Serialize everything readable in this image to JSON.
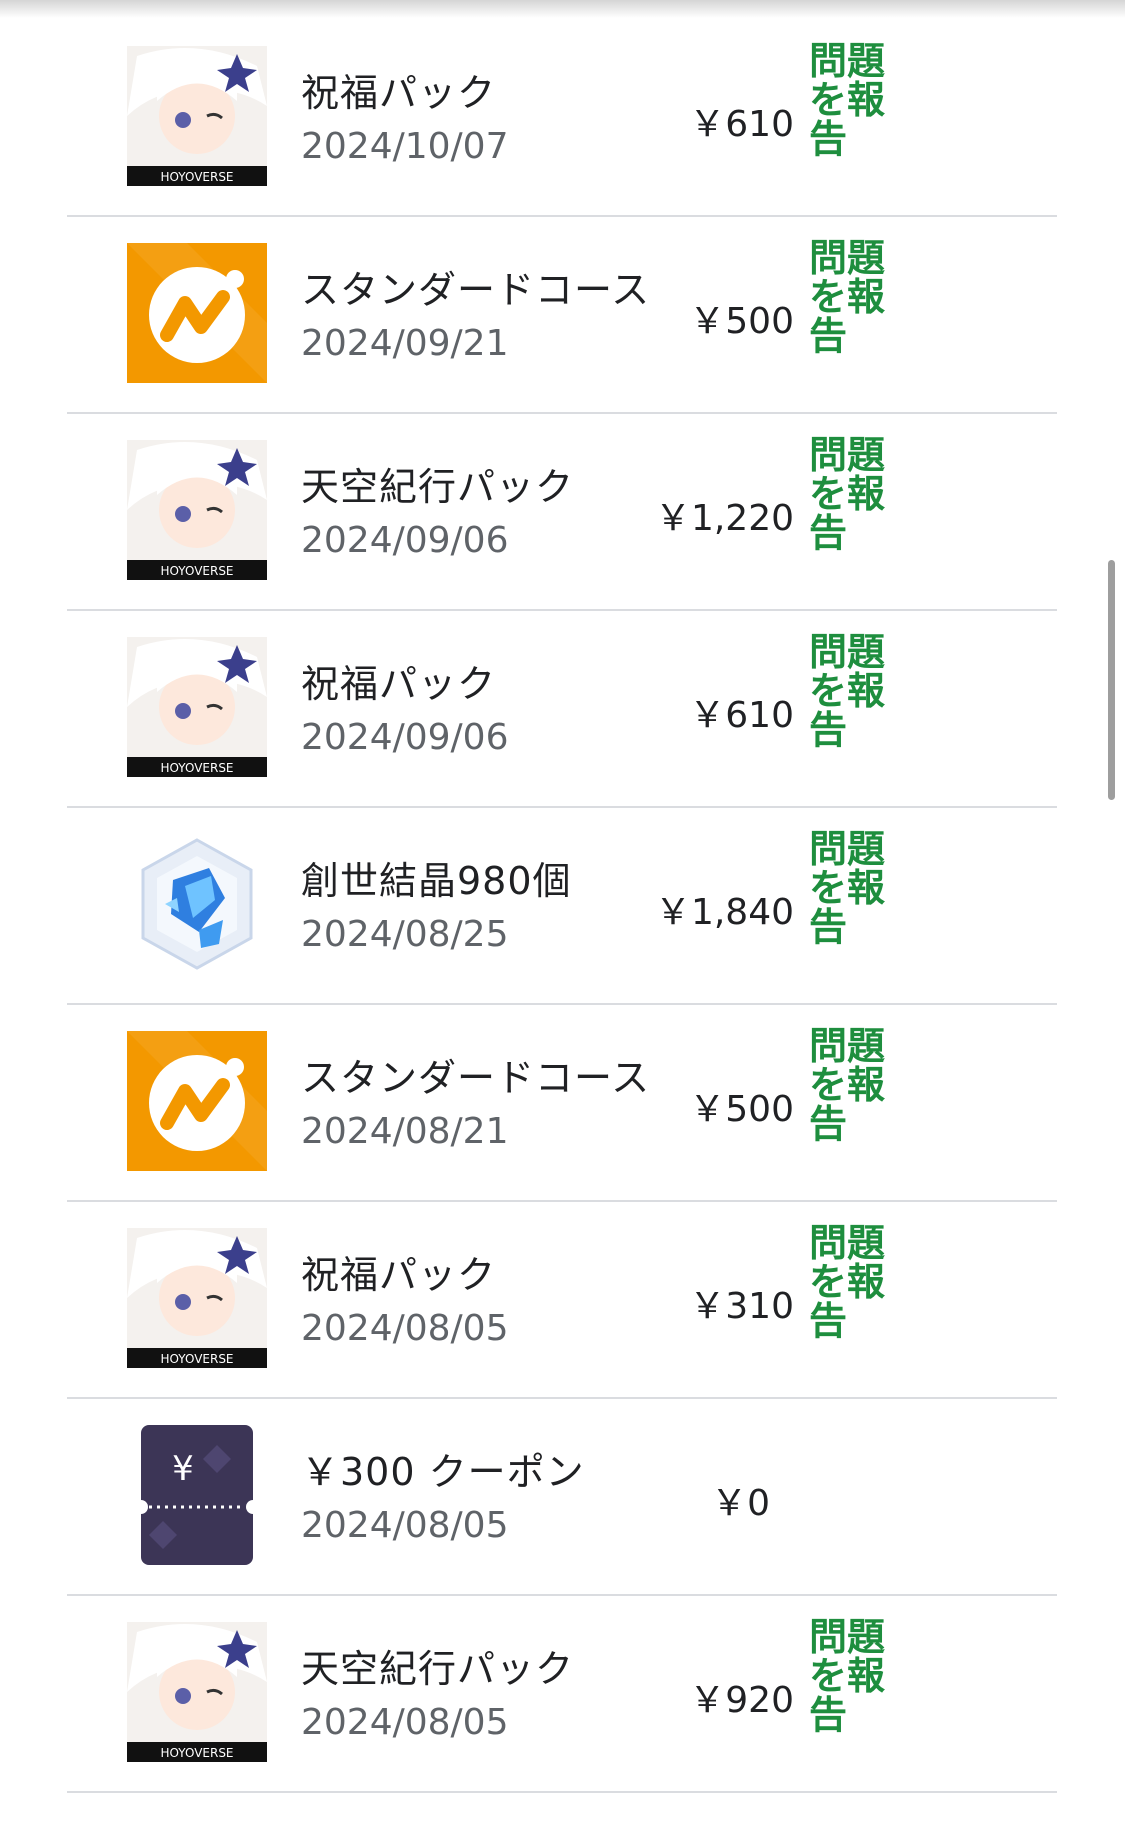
{
  "purchases": [
    {
      "name": "祝福パック",
      "date": "2024/10/07",
      "price": "￥610",
      "report": "問題を報告",
      "icon": "hoyoverse-paimon-icon"
    },
    {
      "name": "スタンダードコース",
      "date": "2024/09/21",
      "price": "￥500",
      "report": "問題を報告",
      "icon": "moneyforward-icon"
    },
    {
      "name": "天空紀行パック",
      "date": "2024/09/06",
      "price": "￥1,220",
      "report": "問題を報告",
      "icon": "hoyoverse-paimon-icon"
    },
    {
      "name": "祝福パック",
      "date": "2024/09/06",
      "price": "￥610",
      "report": "問題を報告",
      "icon": "hoyoverse-paimon-icon"
    },
    {
      "name": "創世結晶980個",
      "date": "2024/08/25",
      "price": "￥1,840",
      "report": "問題を報告",
      "icon": "genesis-crystal-icon"
    },
    {
      "name": "スタンダードコース",
      "date": "2024/08/21",
      "price": "￥500",
      "report": "問題を報告",
      "icon": "moneyforward-icon"
    },
    {
      "name": "祝福パック",
      "date": "2024/08/05",
      "price": "￥310",
      "report": "問題を報告",
      "icon": "hoyoverse-paimon-icon"
    },
    {
      "name": "￥300 クーポン",
      "date": "2024/08/05",
      "price": "￥0",
      "report": "",
      "icon": "coupon-icon"
    },
    {
      "name": "天空紀行パック",
      "date": "2024/08/05",
      "price": "￥920",
      "report": "問題を報告",
      "icon": "hoyoverse-paimon-icon"
    }
  ],
  "brand_label": "HOYOVERSE",
  "coupon_symbol": "¥",
  "colors": {
    "report": "#1e8e3e",
    "moneyforward": "#f39800",
    "coupon": "#3c3556"
  }
}
